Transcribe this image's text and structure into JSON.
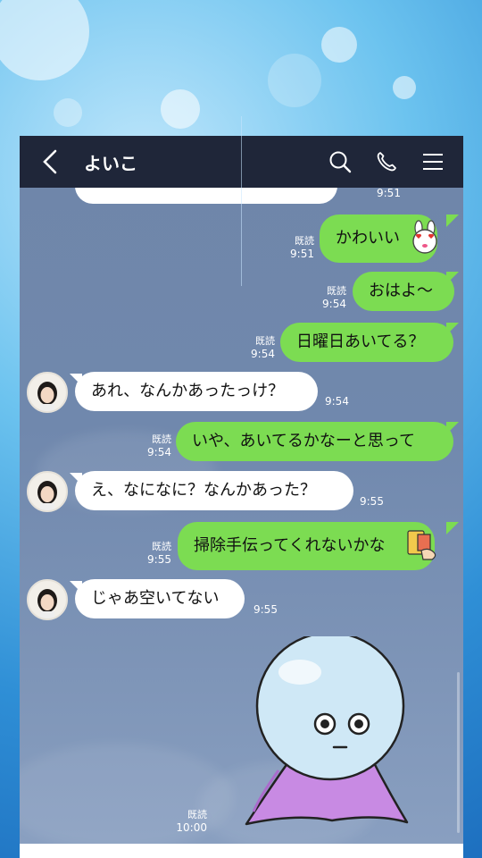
{
  "header": {
    "title": "よいこ",
    "back_icon": "chevron-left-icon",
    "search_icon": "search-icon",
    "call_icon": "phone-icon",
    "menu_icon": "menu-icon"
  },
  "messages": [
    {
      "id": "m0",
      "dir": "in-partial",
      "text": "",
      "time": "9:51"
    },
    {
      "id": "m1",
      "dir": "out",
      "text": "かわいい",
      "read": "既読",
      "time": "9:51",
      "sticker": "bunny-heart-eyes-icon"
    },
    {
      "id": "m2",
      "dir": "out",
      "text": "おはよ〜",
      "read": "既読",
      "time": "9:54"
    },
    {
      "id": "m3",
      "dir": "out",
      "text": "日曜日あいてる？",
      "read": "既読",
      "time": "9:54"
    },
    {
      "id": "m4",
      "dir": "in",
      "text": "あれ、なんかあったっけ？",
      "time": "9:54"
    },
    {
      "id": "m5",
      "dir": "out",
      "text": "いや、あいてるかなーと思って",
      "read": "既読",
      "time": "9:54"
    },
    {
      "id": "m6",
      "dir": "in",
      "text": "え、なになに？なんかあった？",
      "time": "9:55"
    },
    {
      "id": "m7",
      "dir": "out",
      "text": "掃除手伝ってくれないかな",
      "read": "既読",
      "time": "9:55",
      "sticker": "cleaning-hand-icon"
    },
    {
      "id": "m8",
      "dir": "in",
      "text": "じゃあ空いてない",
      "time": "9:55"
    },
    {
      "id": "m9",
      "dir": "out-sticker",
      "read": "既読",
      "time": "10:00",
      "sticker": "round-ghost-character-sticker"
    }
  ],
  "colors": {
    "outgoing": "#7cdc52",
    "incoming": "#ffffff",
    "header": "#1f2639",
    "chat_bg": "#7088ad"
  }
}
